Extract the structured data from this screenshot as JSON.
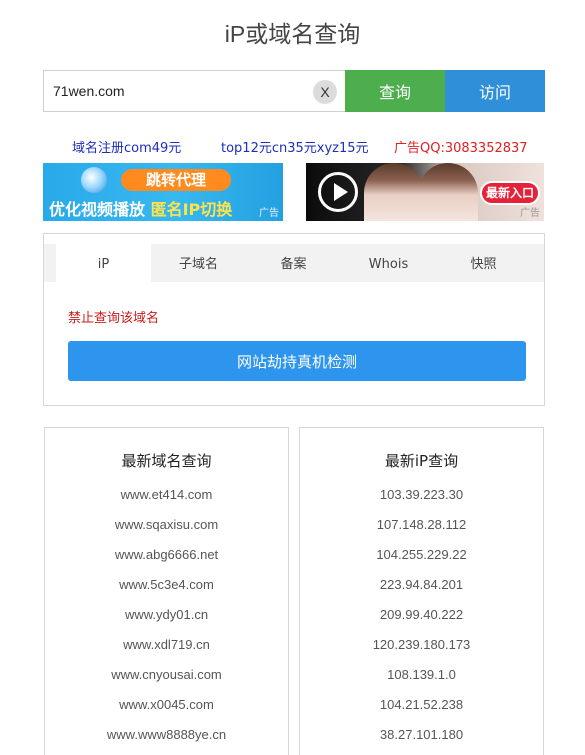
{
  "title": "iP或域名查询",
  "search": {
    "value": "71wen.com",
    "clear_label": "X",
    "query_label": "查询",
    "visit_label": "访问"
  },
  "ad_links": [
    "域名注册com49元",
    "top12元cn35元xyz15元",
    "广告QQ:3083352837"
  ],
  "banners": {
    "left": {
      "tag": "跳转代理",
      "text_a": "优化视频播放",
      "text_b": "匿名IP切换",
      "ad_mark": "广告"
    },
    "right": {
      "entry": "最新入口",
      "ad_mark": "广告"
    }
  },
  "tabs": [
    "iP",
    "子域名",
    "备案",
    "Whois",
    "快照"
  ],
  "warning": "禁止查询该域名",
  "detect_button": "网站劫持真机检测",
  "latest_domains": {
    "title": "最新域名查询",
    "items": [
      "www.et414.com",
      "www.sqaxisu.com",
      "www.abg6666.net",
      "www.5c3e4.com",
      "www.ydy01.cn",
      "www.xdl719.cn",
      "www.cnyousai.com",
      "www.x0045.com",
      "www.www8888ye.cn"
    ]
  },
  "latest_ips": {
    "title": "最新iP查询",
    "items": [
      "103.39.223.30",
      "107.148.28.112",
      "104.255.229.22",
      "223.94.84.201",
      "209.99.40.222",
      "120.239.180.173",
      "108.139.1.0",
      "104.21.52.238",
      "38.27.101.180"
    ]
  },
  "colors": {
    "query": "#4cae4c",
    "visit": "#2f8fd8",
    "detect": "#2e95ee",
    "warning": "#c91b1b",
    "ad_blue": "#1c2fbd",
    "ad_red": "#e02020"
  }
}
